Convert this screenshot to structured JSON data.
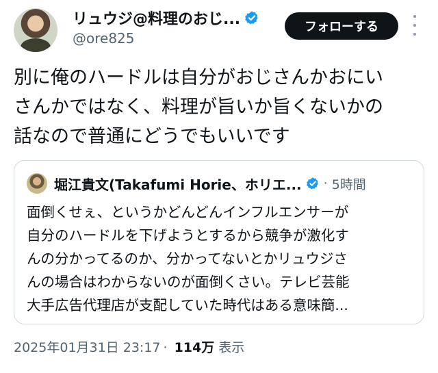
{
  "author": {
    "display_name": "リュウジ@料理のおじ...",
    "handle": "@ore825",
    "verified_icon": "verified-badge-icon",
    "verified_color": "#1d9bf0"
  },
  "follow_button": {
    "label": "フォローする"
  },
  "more_icon": "more-vertical-icon",
  "tweet": {
    "lines": [
      "別に俺のハードルは自分がおじさんかおにい",
      "さんかではなく、料理が旨いか旨くないかの",
      "話なので普通にどうでもいいです"
    ]
  },
  "quoted_tweet": {
    "display_name": "堀江貴文(Takafumi Horie、ホリエ...",
    "separator": "·",
    "time": "5時間",
    "lines": [
      "面倒くせぇ、というかどんどんインフルエンサーが",
      "自分のハードルを下げようとするから競争が激化す",
      "んの分かってるのか、分かってないとかリュウジさ",
      "んの場合はわからないのが面倒くさい。テレビ芸能",
      "大手広告代理店が支配していた時代はある意味簡..."
    ]
  },
  "meta": {
    "timestamp": "2025年01月31日 23:17",
    "dot": "·",
    "views": "114万",
    "views_label": "表示"
  }
}
